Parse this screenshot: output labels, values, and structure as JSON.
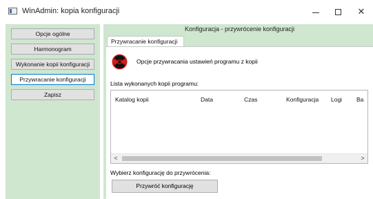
{
  "window": {
    "title": "WinAdmin: kopia konfiguracji"
  },
  "sidebar": {
    "background": "#cfe6cf",
    "items": [
      {
        "label": "Opcje ogólne",
        "active": false
      },
      {
        "label": "Harmonogram",
        "active": false
      },
      {
        "label": "Wykonanie kopii konfiguracji",
        "active": false
      },
      {
        "label": "Przywracanie konfiguracji",
        "active": true
      },
      {
        "label": "Zapisz",
        "active": false
      }
    ]
  },
  "main": {
    "header": "Konfiguracja - przywrócenie konfiguracji",
    "tab_label": "Przywracanie konfiguracji",
    "restore_options_text": "Opcje przywracania ustawień programu z kopii",
    "icon": "radiation-icon",
    "list_label": "Lista wykonanych kopii programu:",
    "columns": [
      "Katalog kopii",
      "Data",
      "Czas",
      "Konfiguracja",
      "Logi",
      "Ba"
    ],
    "rows": [],
    "select_label": "Wybierz konfigurację do przywrócenia:",
    "restore_button": "Przywróć konfigurację"
  },
  "colors": {
    "accent": "#0078d7",
    "panel": "#cfe6cf",
    "button_face": "#e1e1e1",
    "icon_red": "#d11c1c"
  }
}
